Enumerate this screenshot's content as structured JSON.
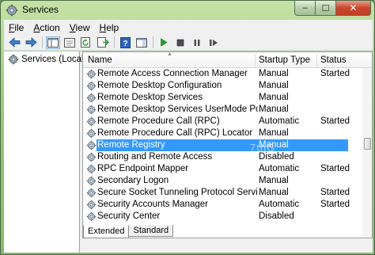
{
  "window": {
    "title": "Services"
  },
  "caption_buttons": {
    "minimize": "–",
    "maximize": "☐",
    "close": "✕"
  },
  "menu": [
    {
      "label": "File",
      "accel": "F",
      "rest": "ile"
    },
    {
      "label": "Action",
      "accel": "A",
      "rest": "ction"
    },
    {
      "label": "View",
      "accel": "V",
      "rest": "iew"
    },
    {
      "label": "Help",
      "accel": "H",
      "rest": "elp"
    }
  ],
  "toolbar": {
    "buttons": [
      "back-icon",
      "forward-icon",
      "show-hide-console-tree-icon",
      "properties-icon",
      "refresh-icon",
      "export-list-icon",
      "help-icon",
      "action-pane-icon",
      "start-service-icon",
      "stop-service-icon",
      "pause-service-icon",
      "restart-service-icon"
    ]
  },
  "tree": {
    "root_label": "Services (Local)"
  },
  "columns": {
    "name": "Name",
    "startup_type": "Startup Type",
    "status": "Status"
  },
  "services": [
    {
      "name": "Remote Access Connection Manager",
      "startup": "Manual",
      "status": "Started"
    },
    {
      "name": "Remote Desktop Configuration",
      "startup": "Manual",
      "status": ""
    },
    {
      "name": "Remote Desktop Services",
      "startup": "Manual",
      "status": ""
    },
    {
      "name": "Remote Desktop Services UserMode Port Redi...",
      "startup": "Manual",
      "status": ""
    },
    {
      "name": "Remote Procedure Call (RPC)",
      "startup": "Automatic",
      "status": "Started"
    },
    {
      "name": "Remote Procedure Call (RPC) Locator",
      "startup": "Manual",
      "status": ""
    },
    {
      "name": "Remote Registry",
      "startup": "Manual",
      "status": "",
      "selected": true
    },
    {
      "name": "Routing and Remote Access",
      "startup": "Disabled",
      "status": ""
    },
    {
      "name": "RPC Endpoint Mapper",
      "startup": "Automatic",
      "status": "Started"
    },
    {
      "name": "Secondary Logon",
      "startup": "Manual",
      "status": ""
    },
    {
      "name": "Secure Socket Tunneling Protocol Service",
      "startup": "Manual",
      "status": "Started"
    },
    {
      "name": "Security Accounts Manager",
      "startup": "Automatic",
      "status": "Started"
    },
    {
      "name": "Security Center",
      "startup": "Disabled",
      "status": ""
    }
  ],
  "tabs": [
    {
      "label": "Extended",
      "active": true
    },
    {
      "label": "Standard",
      "active": false
    }
  ],
  "watermark": "7thG",
  "colors": {
    "selection": "#3399ff",
    "title_glass": "#9cc97e",
    "close_button": "#c9462c"
  }
}
